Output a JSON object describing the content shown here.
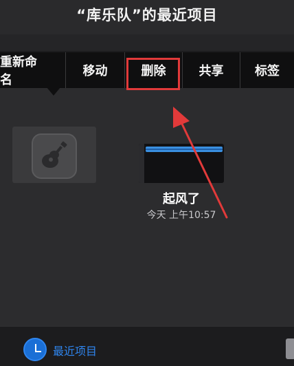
{
  "header": {
    "title": "“库乐队”的最近项目"
  },
  "context_menu": {
    "items": [
      {
        "label": "重新命名"
      },
      {
        "label": "移动"
      },
      {
        "label": "删除"
      },
      {
        "label": "共享"
      },
      {
        "label": "标签"
      }
    ]
  },
  "project": {
    "name": "起风了",
    "date": "今天 上午10:57"
  },
  "tabbar": {
    "recent_label": "最近项目"
  },
  "colors": {
    "accent": "#2f86f0",
    "highlight": "#e23a3a",
    "menu_bg": "#0f0f10"
  },
  "icons": {
    "app_icon": "guitar-icon",
    "recent_icon": "clock-icon"
  }
}
